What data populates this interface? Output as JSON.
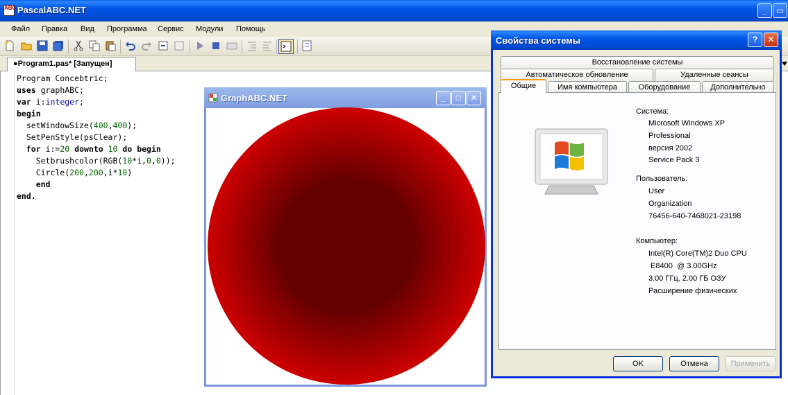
{
  "app": {
    "title": "PascalABC.NET",
    "menu": [
      "Файл",
      "Правка",
      "Вид",
      "Программа",
      "Сервис",
      "Модули",
      "Помощь"
    ],
    "tab_label": "●Program1.pas* [Запущен]"
  },
  "code": {
    "lines": [
      [
        {
          "t": "Program Concebtric;"
        }
      ],
      [
        {
          "t": "uses",
          "k": "kw"
        },
        {
          "t": " graphABC;"
        }
      ],
      [
        {
          "t": "var",
          "k": "kw"
        },
        {
          "t": " i:"
        },
        {
          "t": "integer",
          "k": "ty"
        },
        {
          "t": ";"
        }
      ],
      [
        {
          "t": "begin",
          "k": "kw"
        }
      ],
      [
        {
          "t": "  setWindowSize("
        },
        {
          "t": "400",
          "k": "num"
        },
        {
          "t": ","
        },
        {
          "t": "400",
          "k": "num"
        },
        {
          "t": ");"
        }
      ],
      [
        {
          "t": "  SetPenStyle(psClear);"
        }
      ],
      [
        {
          "t": "  "
        },
        {
          "t": "for",
          "k": "kw"
        },
        {
          "t": " i:="
        },
        {
          "t": "20",
          "k": "num"
        },
        {
          "t": " "
        },
        {
          "t": "downto",
          "k": "kw"
        },
        {
          "t": " "
        },
        {
          "t": "10",
          "k": "num"
        },
        {
          "t": " "
        },
        {
          "t": "do begin",
          "k": "kw"
        }
      ],
      [
        {
          "t": "    Setbrushcolor(RGB("
        },
        {
          "t": "10",
          "k": "num"
        },
        {
          "t": "*i,"
        },
        {
          "t": "0",
          "k": "num"
        },
        {
          "t": ","
        },
        {
          "t": "0",
          "k": "num"
        },
        {
          "t": "));"
        }
      ],
      [
        {
          "t": "    Circle("
        },
        {
          "t": "200",
          "k": "num"
        },
        {
          "t": ","
        },
        {
          "t": "200",
          "k": "num"
        },
        {
          "t": ",i*"
        },
        {
          "t": "10",
          "k": "num"
        },
        {
          "t": ")"
        }
      ],
      [
        {
          "t": "    "
        },
        {
          "t": "end",
          "k": "kw"
        }
      ],
      [
        {
          "t": "end.",
          "k": "kw"
        }
      ]
    ]
  },
  "graph_window": {
    "title": "GraphABC.NET",
    "rings": [
      {
        "i": 20,
        "color": "#c80000"
      },
      {
        "i": 19,
        "color": "#be0000"
      },
      {
        "i": 18,
        "color": "#b40000"
      },
      {
        "i": 17,
        "color": "#aa0000"
      },
      {
        "i": 16,
        "color": "#a00000"
      },
      {
        "i": 15,
        "color": "#960000"
      },
      {
        "i": 14,
        "color": "#8c0000"
      },
      {
        "i": 13,
        "color": "#820000"
      },
      {
        "i": 12,
        "color": "#780000"
      },
      {
        "i": 11,
        "color": "#6e0000"
      },
      {
        "i": 10,
        "color": "#640000"
      }
    ]
  },
  "dialog": {
    "title": "Свойства системы",
    "tabs_row1": [
      "Восстановление системы"
    ],
    "tabs_row2": [
      "Автоматическое обновление",
      "Удаленные сеансы"
    ],
    "tabs_row3": [
      "Общие",
      "Имя компьютера",
      "Оборудование",
      "Дополнительно"
    ],
    "system_label": "Система:",
    "system": [
      "Microsoft Windows XP",
      "Professional",
      "версия 2002",
      "Service Pack 3"
    ],
    "user_label": "Пользователь:",
    "user": [
      "User",
      "Organization",
      "76456-640-7468021-23198"
    ],
    "computer_label": "Компьютер:",
    "computer": [
      "Intel(R) Core(TM)2 Duo CPU",
      " E8400  @ 3.00GHz",
      "3.00 ГГц, 2.00 ГБ ОЗУ",
      "Расширение физических"
    ],
    "buttons": {
      "ok": "OK",
      "cancel": "Отмена",
      "apply": "Применить"
    }
  }
}
